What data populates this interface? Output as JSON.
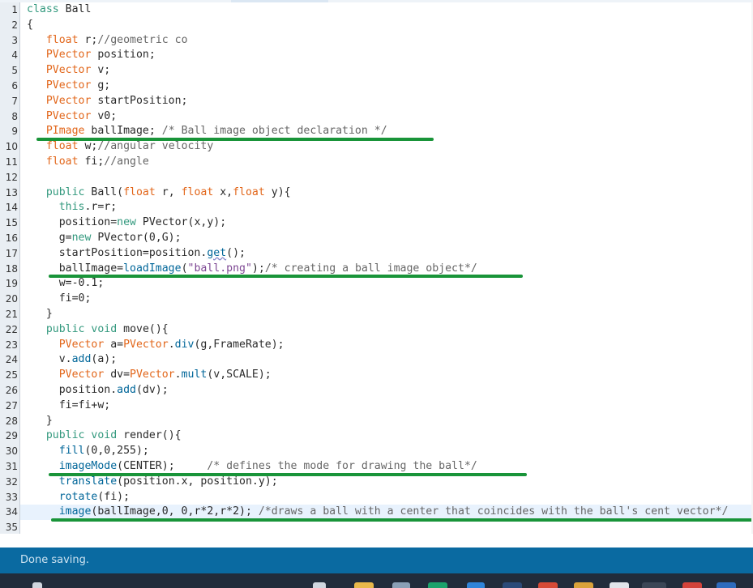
{
  "editor": {
    "lines": [
      {
        "n": "1",
        "tokens": [
          {
            "t": "class",
            "c": "kw"
          },
          {
            "t": " Ball",
            "c": ""
          }
        ]
      },
      {
        "n": "2",
        "tokens": [
          {
            "t": "{",
            "c": ""
          }
        ]
      },
      {
        "n": "3",
        "tokens": [
          {
            "t": "   ",
            "c": ""
          },
          {
            "t": "float",
            "c": "typ"
          },
          {
            "t": " r;",
            "c": ""
          },
          {
            "t": "//geometric co",
            "c": "cm"
          }
        ]
      },
      {
        "n": "4",
        "tokens": [
          {
            "t": "   ",
            "c": ""
          },
          {
            "t": "PVector",
            "c": "typ"
          },
          {
            "t": " position;",
            "c": ""
          }
        ]
      },
      {
        "n": "5",
        "tokens": [
          {
            "t": "   ",
            "c": ""
          },
          {
            "t": "PVector",
            "c": "typ"
          },
          {
            "t": " v;",
            "c": ""
          }
        ]
      },
      {
        "n": "6",
        "tokens": [
          {
            "t": "   ",
            "c": ""
          },
          {
            "t": "PVector",
            "c": "typ"
          },
          {
            "t": " g;",
            "c": ""
          }
        ]
      },
      {
        "n": "7",
        "tokens": [
          {
            "t": "   ",
            "c": ""
          },
          {
            "t": "PVector",
            "c": "typ"
          },
          {
            "t": " startPosition;",
            "c": ""
          }
        ]
      },
      {
        "n": "8",
        "tokens": [
          {
            "t": "   ",
            "c": ""
          },
          {
            "t": "PVector",
            "c": "typ"
          },
          {
            "t": " v0;",
            "c": ""
          }
        ]
      },
      {
        "n": "9",
        "tokens": [
          {
            "t": "   ",
            "c": ""
          },
          {
            "t": "PImage",
            "c": "typ"
          },
          {
            "t": " ballImage; ",
            "c": ""
          },
          {
            "t": "/* Ball image object declaration */",
            "c": "cm"
          }
        ]
      },
      {
        "n": "10",
        "tokens": [
          {
            "t": "   ",
            "c": ""
          },
          {
            "t": "float",
            "c": "typ"
          },
          {
            "t": " w;",
            "c": ""
          },
          {
            "t": "//angular velocity",
            "c": "cm"
          }
        ]
      },
      {
        "n": "11",
        "tokens": [
          {
            "t": "   ",
            "c": ""
          },
          {
            "t": "float",
            "c": "typ"
          },
          {
            "t": " fi;",
            "c": ""
          },
          {
            "t": "//angle",
            "c": "cm"
          }
        ]
      },
      {
        "n": "12",
        "tokens": []
      },
      {
        "n": "13",
        "tokens": [
          {
            "t": "   ",
            "c": ""
          },
          {
            "t": "public",
            "c": "kw"
          },
          {
            "t": " Ball(",
            "c": ""
          },
          {
            "t": "float",
            "c": "typ"
          },
          {
            "t": " r, ",
            "c": ""
          },
          {
            "t": "float",
            "c": "typ"
          },
          {
            "t": " x,",
            "c": ""
          },
          {
            "t": "float",
            "c": "typ"
          },
          {
            "t": " y){",
            "c": ""
          }
        ]
      },
      {
        "n": "14",
        "tokens": [
          {
            "t": "     ",
            "c": ""
          },
          {
            "t": "this",
            "c": "kw"
          },
          {
            "t": ".r=r;",
            "c": ""
          }
        ]
      },
      {
        "n": "15",
        "tokens": [
          {
            "t": "     position=",
            "c": ""
          },
          {
            "t": "new",
            "c": "kw"
          },
          {
            "t": " PVector(x,y);",
            "c": ""
          }
        ]
      },
      {
        "n": "16",
        "tokens": [
          {
            "t": "     g=",
            "c": ""
          },
          {
            "t": "new",
            "c": "kw"
          },
          {
            "t": " PVector(0,G);",
            "c": ""
          }
        ]
      },
      {
        "n": "17",
        "tokens": [
          {
            "t": "     startPosition=position.",
            "c": ""
          },
          {
            "t": "get",
            "c": "fn squiggle"
          },
          {
            "t": "();",
            "c": ""
          }
        ]
      },
      {
        "n": "18",
        "tokens": [
          {
            "t": "     ballImage=",
            "c": ""
          },
          {
            "t": "loadImage",
            "c": "fn"
          },
          {
            "t": "(",
            "c": ""
          },
          {
            "t": "\"ball.png\"",
            "c": "str"
          },
          {
            "t": ");",
            "c": ""
          },
          {
            "t": "/* creating a ball image object*/",
            "c": "cm"
          }
        ]
      },
      {
        "n": "19",
        "tokens": [
          {
            "t": "     w=-0.1;",
            "c": ""
          }
        ]
      },
      {
        "n": "20",
        "tokens": [
          {
            "t": "     fi=0;",
            "c": ""
          }
        ]
      },
      {
        "n": "21",
        "tokens": [
          {
            "t": "   }",
            "c": ""
          }
        ]
      },
      {
        "n": "22",
        "tokens": [
          {
            "t": "   ",
            "c": ""
          },
          {
            "t": "public",
            "c": "kw"
          },
          {
            "t": " ",
            "c": ""
          },
          {
            "t": "void",
            "c": "kw"
          },
          {
            "t": " move(){",
            "c": ""
          }
        ]
      },
      {
        "n": "23",
        "tokens": [
          {
            "t": "     ",
            "c": ""
          },
          {
            "t": "PVector",
            "c": "typ"
          },
          {
            "t": " a=",
            "c": ""
          },
          {
            "t": "PVector",
            "c": "typ"
          },
          {
            "t": ".",
            "c": ""
          },
          {
            "t": "div",
            "c": "fn"
          },
          {
            "t": "(g,FrameRate);",
            "c": ""
          }
        ]
      },
      {
        "n": "24",
        "tokens": [
          {
            "t": "     v.",
            "c": ""
          },
          {
            "t": "add",
            "c": "fn"
          },
          {
            "t": "(a);",
            "c": ""
          }
        ]
      },
      {
        "n": "25",
        "tokens": [
          {
            "t": "     ",
            "c": ""
          },
          {
            "t": "PVector",
            "c": "typ"
          },
          {
            "t": " dv=",
            "c": ""
          },
          {
            "t": "PVector",
            "c": "typ"
          },
          {
            "t": ".",
            "c": ""
          },
          {
            "t": "mult",
            "c": "fn"
          },
          {
            "t": "(v,SCALE);",
            "c": ""
          }
        ]
      },
      {
        "n": "26",
        "tokens": [
          {
            "t": "     position.",
            "c": ""
          },
          {
            "t": "add",
            "c": "fn"
          },
          {
            "t": "(dv);",
            "c": ""
          }
        ]
      },
      {
        "n": "27",
        "tokens": [
          {
            "t": "     fi=fi+w;",
            "c": ""
          }
        ]
      },
      {
        "n": "28",
        "tokens": [
          {
            "t": "   }",
            "c": ""
          }
        ]
      },
      {
        "n": "29",
        "tokens": [
          {
            "t": "   ",
            "c": ""
          },
          {
            "t": "public",
            "c": "kw"
          },
          {
            "t": " ",
            "c": ""
          },
          {
            "t": "void",
            "c": "kw"
          },
          {
            "t": " render(){",
            "c": ""
          }
        ]
      },
      {
        "n": "30",
        "tokens": [
          {
            "t": "     ",
            "c": ""
          },
          {
            "t": "fill",
            "c": "fn"
          },
          {
            "t": "(0,0,255);",
            "c": ""
          }
        ]
      },
      {
        "n": "31",
        "tokens": [
          {
            "t": "     ",
            "c": ""
          },
          {
            "t": "imageMode",
            "c": "fn"
          },
          {
            "t": "(CENTER);     ",
            "c": ""
          },
          {
            "t": "/* defines the mode for drawing the ball*/",
            "c": "cm"
          }
        ]
      },
      {
        "n": "32",
        "tokens": [
          {
            "t": "     ",
            "c": ""
          },
          {
            "t": "translate",
            "c": "fn"
          },
          {
            "t": "(position.x, position.y);",
            "c": ""
          }
        ]
      },
      {
        "n": "33",
        "tokens": [
          {
            "t": "     ",
            "c": ""
          },
          {
            "t": "rotate",
            "c": "fn"
          },
          {
            "t": "(fi);",
            "c": ""
          }
        ]
      },
      {
        "n": "34",
        "current": true,
        "tokens": [
          {
            "t": "     ",
            "c": ""
          },
          {
            "t": "image",
            "c": "fn"
          },
          {
            "t": "(ballImage,0, 0,r*2,r*2); ",
            "c": ""
          },
          {
            "t": "/*draws a ball with a center that coincides with the ball's cent vector*/",
            "c": "cm"
          }
        ]
      },
      {
        "n": "35",
        "tokens": []
      }
    ]
  },
  "status": {
    "message": "Done saving."
  },
  "colors": {
    "keyword": "#33997e",
    "type": "#e2661a",
    "function": "#006699",
    "comment": "#666666",
    "string": "#7d4793",
    "highlight": "#199439",
    "status_bar": "#0a6aa1",
    "taskbar": "#212c3b"
  }
}
